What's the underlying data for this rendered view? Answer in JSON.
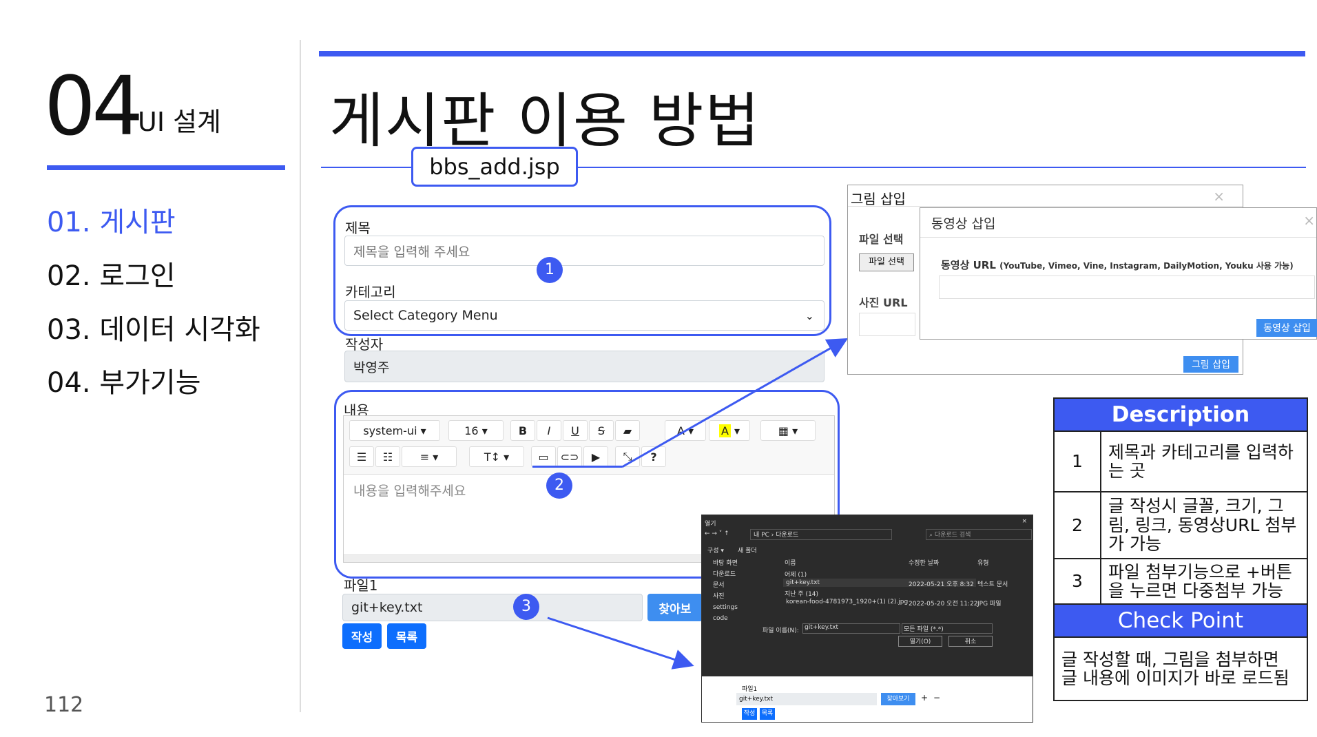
{
  "section": {
    "number": "04",
    "name": "UI 설계"
  },
  "nav": [
    {
      "label": "01. 게시판",
      "active": true
    },
    {
      "label": "02. 로그인",
      "active": false
    },
    {
      "label": "03. 데이터 시각화",
      "active": false
    },
    {
      "label": "04. 부가기능",
      "active": false
    }
  ],
  "page_number": "112",
  "title": "게시판 이용 방법",
  "file_tag": "bbs_add.jsp",
  "form": {
    "title_label": "제목",
    "title_placeholder": "제목을 입력해 주세요",
    "category_label": "카테고리",
    "category_value": "Select Category Menu",
    "author_label": "작성자",
    "author_value": "박영주",
    "content_label": "내용",
    "font_family": "system-ui",
    "font_size": "16",
    "content_placeholder": "내용을 입력해주세요",
    "file_label": "파일1",
    "file_value": "git+key.txt",
    "browse_label": "찾아보",
    "submit_label": "작성",
    "list_label": "목록"
  },
  "badges": [
    "1",
    "2",
    "3"
  ],
  "image_modal": {
    "title": "그림 삽입",
    "file_select_label": "파일 선택",
    "file_select_button": "파일 선택",
    "url_label": "사진 URL",
    "insert_button": "그림 삽입"
  },
  "video_modal": {
    "title": "동영상 삽입",
    "url_label": "동영상 URL",
    "url_hint": "(YouTube, Vimeo, Vine, Instagram, DailyMotion, Youku 사용 가능)",
    "insert_button": "동영상 삽입"
  },
  "description": {
    "header": "Description",
    "rows": [
      {
        "num": "1",
        "text": "제목과 카테고리를 입력하는 곳"
      },
      {
        "num": "2",
        "text": " 글 작성시 글꼴, 크기, 그림, 링크, 동영상URL 첨부가 가능"
      },
      {
        "num": "3",
        "text": "파일 첨부기능으로 +버튼을 누르면 다중첨부 가능"
      }
    ],
    "check_header": "Check Point",
    "check_text": "글 작성할 때, 그림을 첨부하면 글 내용에 이미지가 바로 로드됨"
  },
  "file_dialog": {
    "title": "열기",
    "path": [
      "내 PC",
      "다운로드"
    ],
    "search_placeholder": "다운로드 검색",
    "organize": "구성 ▾",
    "new_folder": "새 폴더",
    "sidebar": [
      "바탕 화면",
      "다운로드",
      "문서",
      "사진",
      "settings",
      "code"
    ],
    "columns": [
      "이름",
      "수정한 날짜",
      "유형"
    ],
    "groups": [
      "어제 (1)",
      "지난 주 (14)"
    ],
    "files": [
      {
        "name": "git+key.txt",
        "date": "2022-05-21 오후 8:32",
        "type": "텍스트 문서"
      },
      {
        "name": "korean-food-4781973_1920+(1) (2).jpg",
        "date": "2022-05-20 오전 11:22",
        "type": "JPG 파일"
      }
    ],
    "filename_label": "파일 이름(N):",
    "filename_value": "git+key.txt",
    "filter": "모든 파일 (*.*)",
    "open_button": "열기(O)",
    "cancel_button": "취소",
    "below_label": "파일1",
    "below_value": "git+key.txt",
    "below_browse": "찾아보기",
    "below_submit": "작성",
    "below_list": "목록"
  },
  "colors": {
    "accent": "#3d5af1",
    "button": "#0d6efd"
  }
}
